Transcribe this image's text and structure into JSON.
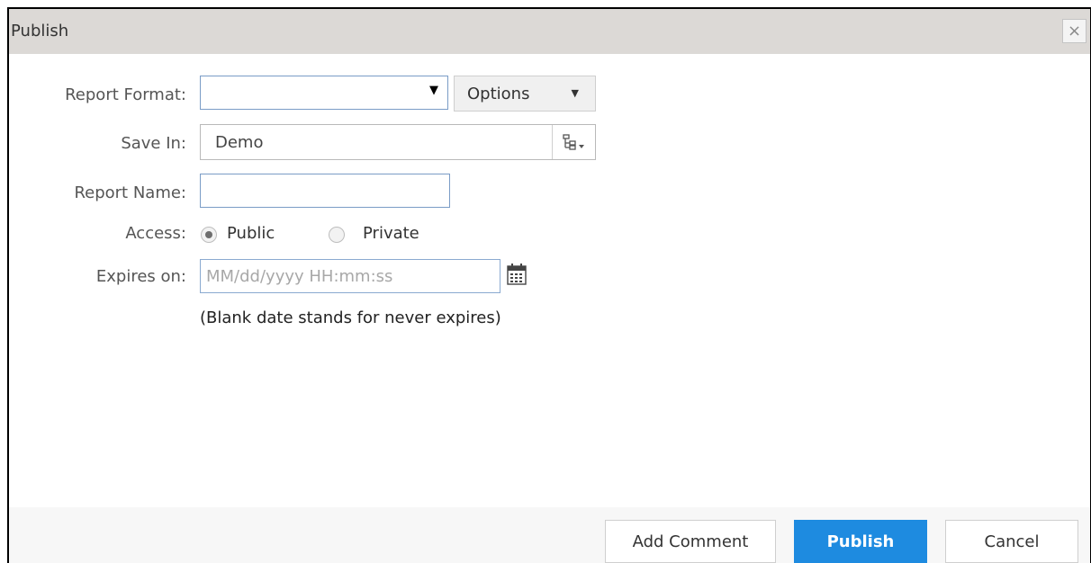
{
  "dialog": {
    "title": "Publish",
    "close_glyph": "×"
  },
  "form": {
    "report_format": {
      "label": "Report Format:",
      "value": "",
      "arrow_glyph": "▼"
    },
    "options_button": {
      "label": "Options",
      "caret_glyph": "▼"
    },
    "save_in": {
      "label": "Save In:",
      "value": "Demo",
      "icon": "tree-folder-icon"
    },
    "report_name": {
      "label": "Report Name:",
      "value": ""
    },
    "access": {
      "label": "Access:",
      "options": [
        {
          "label": "Public",
          "selected": true
        },
        {
          "label": "Private",
          "selected": false
        }
      ]
    },
    "expires_on": {
      "label": "Expires on:",
      "value": "",
      "placeholder": "MM/dd/yyyy HH:mm:ss",
      "icon": "calendar-icon"
    },
    "hint": "(Blank date stands for never expires)"
  },
  "footer": {
    "add_comment_label": "Add Comment",
    "publish_label": "Publish",
    "cancel_label": "Cancel"
  },
  "colors": {
    "titlebar": "#dcd9d6",
    "primary_button": "#1e8be0",
    "footer_bg": "#f7f7f7"
  }
}
